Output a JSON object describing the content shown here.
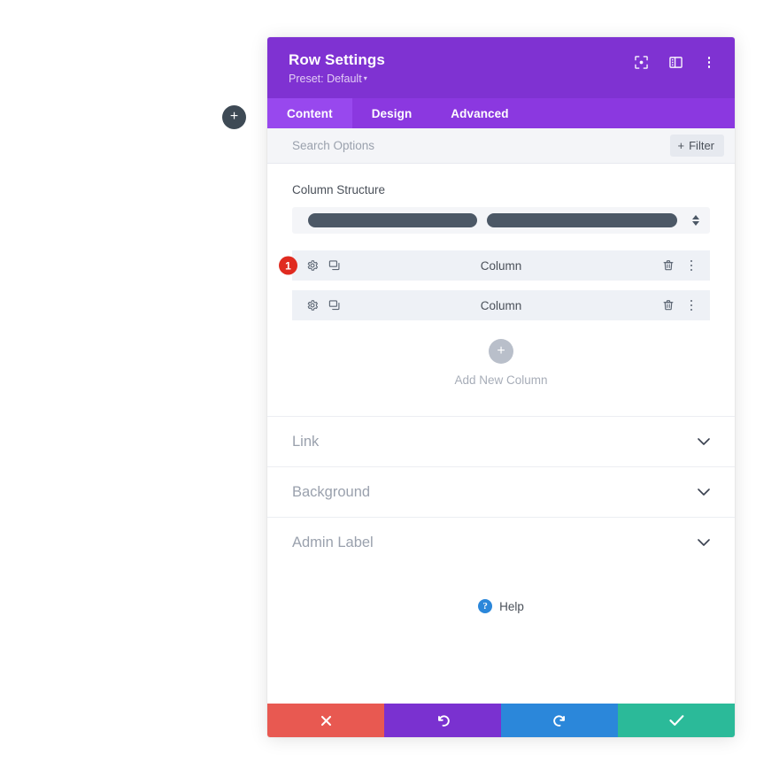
{
  "canvas": {
    "floating_add_button": {
      "name": "add-section-button",
      "glyph": "+"
    }
  },
  "modal": {
    "header": {
      "title": "Row Settings",
      "preset_label": "Preset: Default",
      "preset_caret": "▾",
      "actions": [
        {
          "name": "focus-mode-icon",
          "title": "Focus"
        },
        {
          "name": "layout-panel-icon",
          "title": "Layout"
        },
        {
          "name": "more-options-icon",
          "title": "More"
        }
      ]
    },
    "tabs": [
      {
        "label": "Content",
        "active": true
      },
      {
        "label": "Design",
        "active": false
      },
      {
        "label": "Advanced",
        "active": false
      }
    ],
    "search": {
      "placeholder": "Search Options",
      "value": "",
      "filter_label": "Filter",
      "filter_plus": "+"
    },
    "content": {
      "column_structure": {
        "label": "Column Structure",
        "columns": [
          {
            "width_fraction": 0.47
          },
          {
            "width_fraction": 0.53
          }
        ]
      },
      "columns": [
        {
          "title": "Column",
          "badge": "1",
          "has_badge": true,
          "settings_icon": "gear-icon",
          "duplicate_icon": "duplicate-icon",
          "delete_icon": "trash-icon",
          "more_icon": "kebab-menu-icon"
        },
        {
          "title": "Column",
          "badge": "",
          "has_badge": false,
          "settings_icon": "gear-icon",
          "duplicate_icon": "duplicate-icon",
          "delete_icon": "trash-icon",
          "more_icon": "kebab-menu-icon"
        }
      ],
      "add_new_column": {
        "glyph": "+",
        "label": "Add New Column"
      },
      "accordions": [
        {
          "label": "Link",
          "expanded": false
        },
        {
          "label": "Background",
          "expanded": false
        },
        {
          "label": "Admin Label",
          "expanded": false
        }
      ],
      "help": {
        "glyph": "?",
        "label": "Help"
      }
    },
    "footer": [
      {
        "name": "cancel-button",
        "icon": "close-icon",
        "color": "#e85951"
      },
      {
        "name": "undo-button",
        "icon": "undo-icon",
        "color": "#7a31d0"
      },
      {
        "name": "redo-button",
        "icon": "redo-icon",
        "color": "#2b87da"
      },
      {
        "name": "save-button",
        "icon": "check-icon",
        "color": "#2bba99"
      }
    ]
  },
  "colors": {
    "header_purple": "#7f32d2",
    "tabbar_purple": "#8b38e0",
    "active_tab_purple": "#9848ee",
    "badge_red": "#e02b20",
    "row_bg": "#eef1f6",
    "structure_bar": "#4c5866",
    "help_blue": "#2b87da"
  }
}
